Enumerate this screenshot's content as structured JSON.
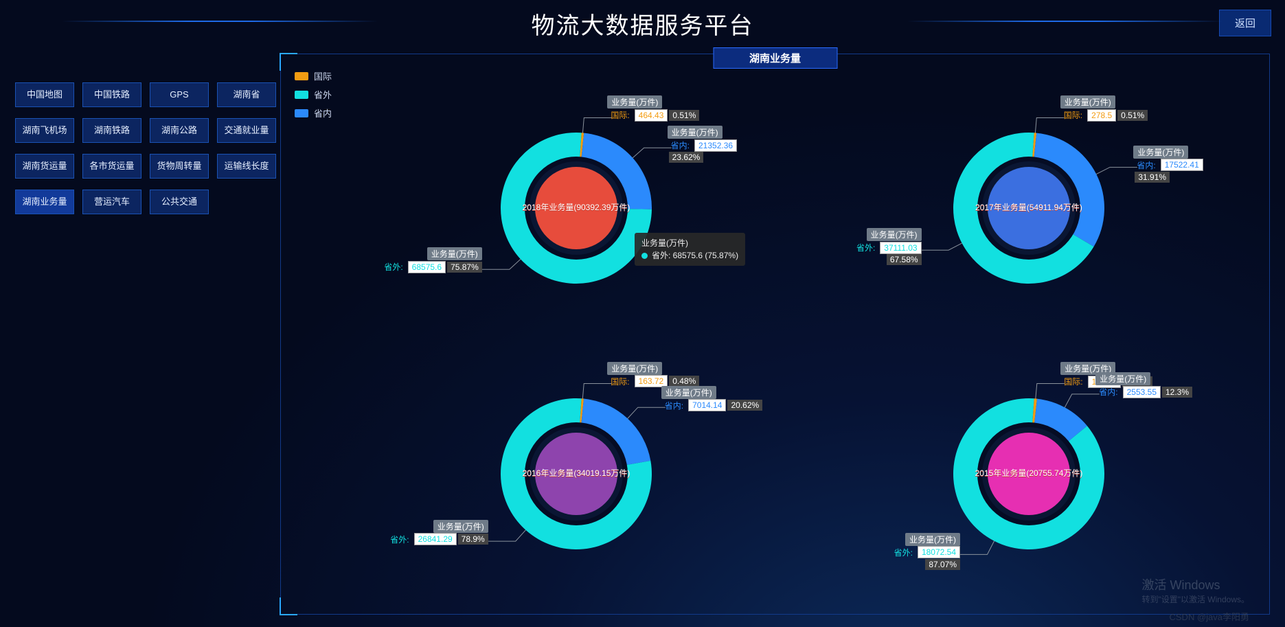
{
  "header": {
    "title": "物流大数据服务平台",
    "back": "返回"
  },
  "nav": [
    [
      "中国地图",
      "中国铁路",
      "GPS",
      "湖南省"
    ],
    [
      "湖南飞机场",
      "湖南铁路",
      "湖南公路",
      "交通就业量"
    ],
    [
      "湖南货运量",
      "各市货运量",
      "货物周转量",
      "运输线长度"
    ],
    [
      "湖南业务量",
      "营运汽车",
      "公共交通"
    ]
  ],
  "active_nav": "湖南业务量",
  "panel_title": "湖南业务量",
  "legend": [
    {
      "name": "国际",
      "color": "#f39c12"
    },
    {
      "name": "省外",
      "color": "#12e0e0"
    },
    {
      "name": "省内",
      "color": "#2b8afc"
    }
  ],
  "metric_label": "业务量(万件)",
  "tooltip": {
    "title": "业务量(万件)",
    "series": "省外",
    "value": 68575.6,
    "pct": "75.87%",
    "color": "#12e0e0"
  },
  "chart_data": {
    "type": "pie",
    "series_meta": [
      {
        "key": "intl",
        "name": "国际",
        "color": "#f39c12"
      },
      {
        "key": "out",
        "name": "省外",
        "color": "#12e0e0"
      },
      {
        "key": "in",
        "name": "省内",
        "color": "#2b8afc"
      }
    ],
    "charts": [
      {
        "year": 2018,
        "title": "2018年业务量(90392.39万件)",
        "total": 90392.39,
        "inner_color": "#e74c3c",
        "slices": {
          "intl": {
            "v": 464.43,
            "p": "0.51%"
          },
          "out": {
            "v": 68575.6,
            "p": "75.87%"
          },
          "in": {
            "v": 21352.36,
            "p": "23.62%"
          }
        }
      },
      {
        "year": 2017,
        "title": "2017年业务量(54911.94万件)",
        "total": 54911.94,
        "inner_color": "#3b6fe0",
        "slices": {
          "intl": {
            "v": 278.5,
            "p": "0.51%"
          },
          "out": {
            "v": 37111.03,
            "p": "67.58%"
          },
          "in": {
            "v": 17522.41,
            "p": "31.91%"
          }
        }
      },
      {
        "year": 2016,
        "title": "2016年业务量(34019.15万件)",
        "total": 34019.15,
        "inner_color": "#8e44ad",
        "slices": {
          "intl": {
            "v": 163.72,
            "p": "0.48%"
          },
          "out": {
            "v": 26841.29,
            "p": "78.9%"
          },
          "in": {
            "v": 7014.14,
            "p": "20.62%"
          }
        }
      },
      {
        "year": 2015,
        "title": "2015年业务量(20755.74万件)",
        "total": 20755.74,
        "inner_color": "#e62fb2",
        "slices": {
          "intl": {
            "v": 129.65,
            "p": "0.63%"
          },
          "out": {
            "v": 18072.54,
            "p": "87.07%"
          },
          "in": {
            "v": 2553.55,
            "p": "12.3%"
          }
        }
      }
    ]
  },
  "watermark": {
    "line1": "激活 Windows",
    "line2": "转到\"设置\"以激活 Windows。",
    "csdn": "CSDN @java李阳勇"
  }
}
